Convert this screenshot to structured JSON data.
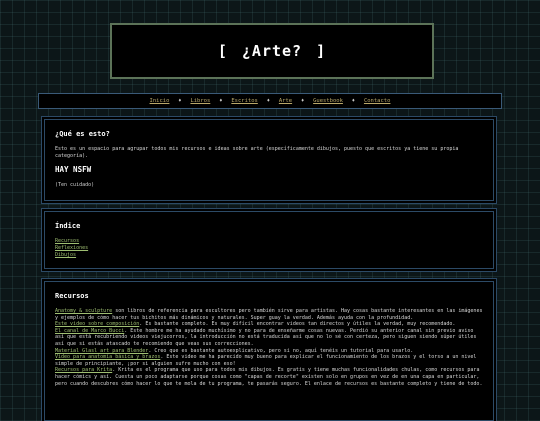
{
  "header": {
    "title": "[ ¿Arte? ]"
  },
  "nav": {
    "items": [
      "Inicio",
      "Libros",
      "Escritos",
      "Arte",
      "Guestbook",
      "Contacto"
    ],
    "separator": "♦"
  },
  "about": {
    "heading": "¿Qué es esto?",
    "body": "Esto es un espacio para agrupar todos mis recursos e ideas sobre arte (específicamente dibujos, puesto que escritos ya tiene su propia categoría).",
    "warning": "HAY NSFW",
    "caution": "(Ten cuidado)"
  },
  "index": {
    "heading": "Índice",
    "items": [
      "Recursos",
      "Reflexiones",
      "Dibujos"
    ]
  },
  "resources": {
    "heading": "Recursos",
    "entries": [
      {
        "link": "Anatomy & sculpture",
        "text": " son libros de referencia para escultores pero también sirve para artistas. Hay cosas bastante interesantes en las imágenes y ejemplos de cómo hacer tus bichitos más dinámicos y naturales. Super guay la verdad. Además ayuda con la profundidad."
      },
      {
        "link": "Este video sobre composición",
        "text": ". Es bastante completo. Es muy difícil encontrar videos tan directos y útiles la verdad, muy recomendado."
      },
      {
        "link": "El canal de Marco Bucci",
        "text": ". Este hombre me ha ayudado muchísimo y no para de enseñarme cosas nuevas. Perdió su anterior canal sin previo aviso así que está recubriendo videos viejucorros, la introducción no está traducida así que no lo sé con certeza, pero siguen siendo súper útiles así que si estás atascado te recomiendo que veas sus correcciones."
      },
      {
        "link": "Material Glasl art para Blender",
        "text": ". Creo que es bastante autoexplicativo, pero si no, aquí tenéis un tutorial para usarlo."
      },
      {
        "link": "Video para anatomía básica y brazos",
        "text": ". Este video me ha parecido muy bueno para explicar el funcionamiento de los brazos y el torso a un nivel simple de principiante, ¡por si alguien sufre mucho con eso!"
      },
      {
        "link": "Recursos para Krita",
        "text": ". Krita es el programa que uso para todos mis dibujos. Es gratis y tiene muchas funcionalidades chulas, como recursos para hacer cómics y así. Cuesta un poco adaptarse porque cosas como \"capas de recorte\" existen solo en grupos en vez de en una capa en particular, pero cuando descubres cómo hacer lo que te mola de tu programa, te pasarás seguro. El enlace de recursos es bastante completo y tiene de todo."
      }
    ]
  }
}
